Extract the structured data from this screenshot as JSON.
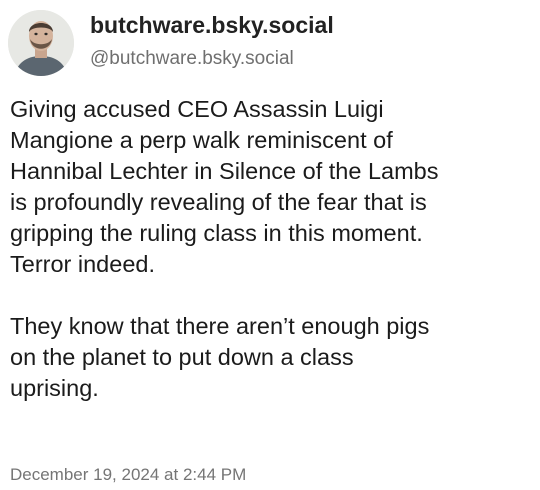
{
  "author": {
    "display_name": "butchware.bsky.social",
    "handle": "@butchware.bsky.social",
    "avatar_icon": "user-avatar"
  },
  "post": {
    "paragraphs": [
      "Giving accused CEO Assassin Luigi\nMangione a perp walk reminiscent of\nHannibal Lechter in Silence of the Lambs\nis profoundly revealing of the fear that is\ngripping the ruling class in this moment.\nTerror indeed.",
      "They know that there aren’t enough pigs\non the planet to put down a class\nuprising."
    ],
    "timestamp": "December 19, 2024 at 2:44 PM"
  },
  "colors": {
    "background": "#ffffff",
    "text": "#1b1b1b",
    "muted": "#757575"
  }
}
